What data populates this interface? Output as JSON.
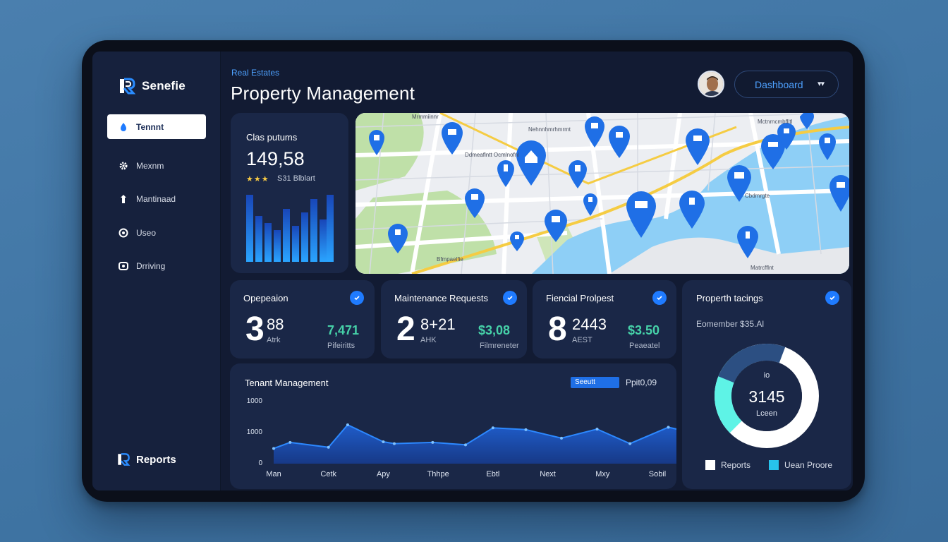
{
  "app": {
    "brand": "Senefie"
  },
  "sidebar": {
    "items": [
      {
        "label": "Tennnt",
        "icon": "drop-icon",
        "active": true
      },
      {
        "label": "Mexnm",
        "icon": "gear-icon"
      },
      {
        "label": "Mantinaad",
        "icon": "person-icon"
      },
      {
        "label": "Useo",
        "icon": "help-icon"
      },
      {
        "label": "Drriving",
        "icon": "camera-icon"
      }
    ],
    "footer_label": "Reports"
  },
  "header": {
    "subtitle": "Real Estates",
    "title": "Property Management",
    "dashboard_select": "Dashboard"
  },
  "summary_card": {
    "label": "Clas putums",
    "value": "149,58",
    "stars": "★★★",
    "stars_text": "S31 Blblart"
  },
  "map": {
    "labels": [
      "Mrmmiinnr",
      "Nehnnhmrhmrmt",
      "Ddmeaflntt Ocmlnofnl",
      "Cbdmrgte",
      "Bfmpaelfie",
      "Mctnrncmbflltl",
      "Matrcfflnt"
    ]
  },
  "kpis": [
    {
      "title": "Opepeaion",
      "big": "3",
      "big_small": "88",
      "sub": "Atrk",
      "value": "7,471",
      "value_sub": "Pifeiritts"
    },
    {
      "title": "Maintenance Requests",
      "big": "2",
      "big_small": "8+21",
      "sub": "AHK",
      "value": "$3,08",
      "value_sub": "Filmreneter"
    },
    {
      "title": "Fiencial Prolpest",
      "big": "8",
      "big_small": "2443",
      "sub": "AEST",
      "value": "$3.50",
      "value_sub": "Peaeatel"
    }
  ],
  "property_listings": {
    "title": "Properth tacings",
    "subtitle": "Eomember $35.Al",
    "center_top": "io",
    "center_value": "3145",
    "center_bottom": "Lceen",
    "legend": [
      {
        "label": "Reports",
        "color": "#ffffff"
      },
      {
        "label": "Uean Proore",
        "color": "#27c3ec"
      }
    ]
  },
  "tenant_chart": {
    "title": "Tenant Management",
    "pill": "Seeutt",
    "pill_value": "Ppit0,09"
  },
  "chart_data": {
    "type": "area",
    "title": "Tenant Management",
    "categories": [
      "Man",
      "Cetk",
      "Apy",
      "Thhpe",
      "Ebtl",
      "Next",
      "Mxy",
      "Sobil"
    ],
    "yticks": [
      "1000",
      "1000",
      "0"
    ],
    "ylim": [
      0,
      1000
    ],
    "x": [
      0,
      0.3,
      1,
      1.35,
      2,
      2.2,
      2.9,
      3.5,
      4,
      4.6,
      5.25,
      5.9,
      6.5,
      7.2,
      8
    ],
    "y": [
      250,
      350,
      270,
      640,
      360,
      330,
      350,
      310,
      590,
      560,
      420,
      570,
      330,
      600,
      440
    ],
    "grid": false,
    "colors": {
      "fill": "#1f5fd0",
      "line": "#2c88ff"
    }
  }
}
